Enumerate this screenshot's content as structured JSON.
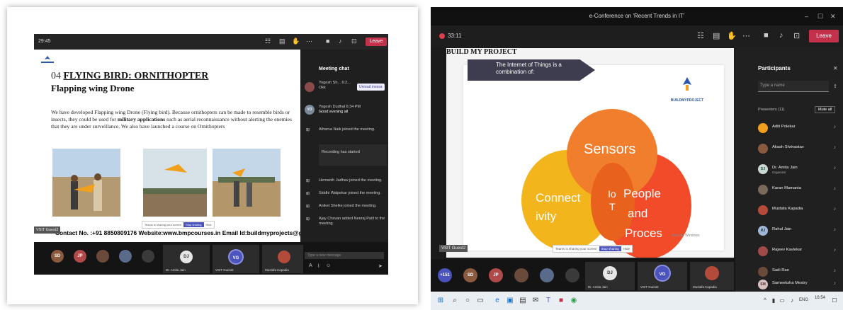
{
  "left": {
    "time": "29:45",
    "leave_label": "Leave",
    "slide": {
      "number": "04",
      "title": "FLYING BIRD: ORNITHOPTER",
      "subtitle": "Flapping wing Drone",
      "body_pre": "We have developed Flapping wing Drone (Flying bird). Because ornithopters can be made to resemble birds or insects, they could be used for ",
      "body_bold": "military applications",
      "body_post": " such as aerial reconnaissance without alerting the enemies that they are under surveillance. We also have launched a course on Ornithopters",
      "contact": "Contact No. :+91 8850809176  Website:www.bmpcourses.in  Email Id:buildmyprojects@gma",
      "guest_tag": "VSIT Guest2",
      "share_text": "Teams is sharing your screen",
      "stop_label": "Stop sharing",
      "hide_label": "Hide"
    },
    "chat": {
      "header": "Meeting chat",
      "unread": "Unread messa",
      "messages": [
        {
          "initials": "",
          "name": "Yogesh Sh... 6:2...",
          "text": "Okk"
        },
        {
          "initials": "YD",
          "name": "Yogesh Dudhal  6:34 PM",
          "text": "Good evening all"
        },
        {
          "initials": "",
          "name": "",
          "text": "Atharva Naik joined the meeting."
        },
        {
          "initials": "",
          "name": "",
          "text": "Recording has started"
        },
        {
          "initials": "",
          "name": "",
          "text": "Hemanth Jadhav joined the meeting."
        },
        {
          "initials": "",
          "name": "",
          "text": "Siddhi Walpekar joined the meeting."
        },
        {
          "initials": "",
          "name": "",
          "text": "Aniket Shelke joined the meeting."
        },
        {
          "initials": "",
          "name": "",
          "text": "Ajay Chavan added Neeraj Patil to the meeting."
        }
      ],
      "type_placeholder": "Type a new message"
    },
    "callbar": {
      "avatars": [
        "SD",
        "JP"
      ],
      "tiles": [
        {
          "initials": "DJ",
          "name": "Dr. Amita Jain"
        },
        {
          "initials": "VG",
          "name": "VSIT Guest2"
        },
        {
          "initials": "",
          "name": "Mustafa Kapadia"
        }
      ]
    }
  },
  "right": {
    "window_title": "e-Conference on 'Recent Trends in IT'",
    "time": "33:11",
    "leave_label": "Leave",
    "slide": {
      "header": "BUILD MY PROJECT",
      "banner": "The Internet of Things is a combination of:",
      "logo_text": "BUILDMYPROJECT",
      "sensors": "Sensors",
      "connectivity_1": "Connect",
      "connectivity_2": "ivity",
      "iot_1": "Io",
      "iot_2": "T",
      "people_1": "People",
      "people_2": "and",
      "people_3": "Proces",
      "activate": "Activate Windows",
      "guest_tag": "VSIT Guest2",
      "share_text": "Teams is sharing your screen",
      "stop_label": "Stop sharing",
      "hide_label": "Hide"
    },
    "participants": {
      "title": "Participants",
      "search_placeholder": "Type a name",
      "presenters_label": "Presenters (11)",
      "mute_all": "Mute all",
      "list": [
        {
          "initials": "",
          "name": "Aditi Polekar",
          "role": ""
        },
        {
          "initials": "",
          "name": "Akash Shrivastav",
          "role": ""
        },
        {
          "initials": "DJ",
          "name": "Dr. Amita Jain",
          "role": "Organizer"
        },
        {
          "initials": "",
          "name": "Karan Mamania",
          "role": ""
        },
        {
          "initials": "",
          "name": "Mustafa Kapadia",
          "role": ""
        },
        {
          "initials": "RJ",
          "name": "Rahul Jain",
          "role": ""
        },
        {
          "initials": "",
          "name": "Rajeev Kavlekar",
          "role": ""
        },
        {
          "initials": "",
          "name": "Sadi Rao",
          "role": ""
        },
        {
          "initials": "SM",
          "name": "Sameeksha Mestry",
          "role": ""
        }
      ]
    },
    "callbar": {
      "count": "+151",
      "avatars": [
        "SD",
        "JP"
      ],
      "tiles": [
        {
          "initials": "DJ",
          "name": "Dr. Amita Jain"
        },
        {
          "initials": "VG",
          "name": "VSIT Guest2"
        },
        {
          "initials": "",
          "name": "Mustafa Kapadia"
        }
      ]
    },
    "taskbar": {
      "lang": "ENG",
      "clock": "16:54"
    }
  }
}
